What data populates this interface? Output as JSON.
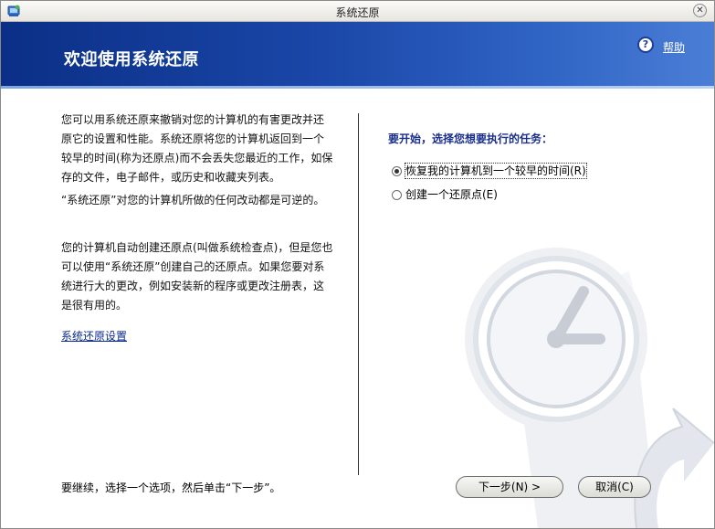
{
  "window": {
    "title": "系统还原"
  },
  "banner": {
    "title": "欢迎使用系统还原",
    "help_label": "帮助",
    "help_icon": "?"
  },
  "left": {
    "paragraph1": "您可以用系统还原来撤销对您的计算机的有害更改并还原它的设置和性能。系统还原将您的计算机返回到一个较早的时间(称为还原点)而不会丢失您最近的工作，如保存的文件，电子邮件，或历史和收藏夹列表。",
    "paragraph2": "“系统还原”对您的计算机所做的任何改动都是可逆的。",
    "paragraph3": "您的计算机自动创建还原点(叫做系统检查点)，但是您也可以使用“系统还原”创建自己的还原点。如果您要对系统进行大的更改，例如安装新的程序或更改注册表，这是很有用的。",
    "settings_link": "系统还原设置",
    "footer_note": "要继续，选择一个选项，然后单击“下一步”。"
  },
  "right": {
    "heading": "要开始，选择您想要执行的任务：",
    "options": [
      {
        "label": "恢复我的计算机到一个较早的时间(R)",
        "checked": true
      },
      {
        "label": "创建一个还原点(E)",
        "checked": false
      }
    ]
  },
  "buttons": {
    "next": "下一步(N) >",
    "cancel": "取消(C)"
  },
  "icons": {
    "close": "✕"
  }
}
